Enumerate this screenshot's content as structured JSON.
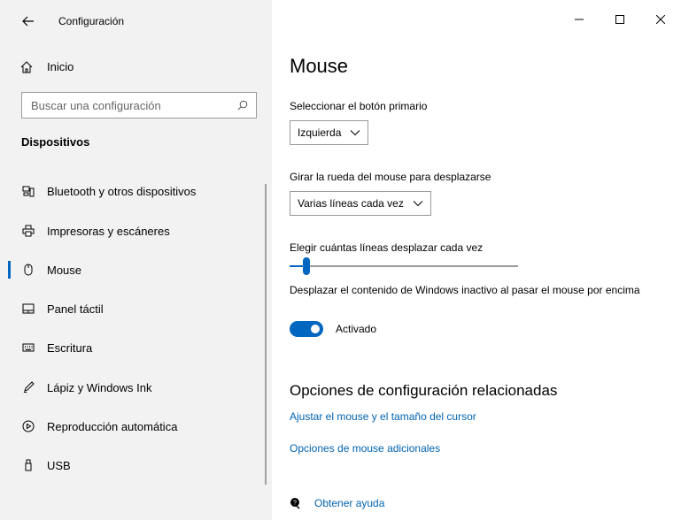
{
  "window": {
    "title": "Configuración"
  },
  "sidebar": {
    "home_label": "Inicio",
    "search_placeholder": "Buscar una configuración",
    "section_heading": "Dispositivos",
    "items": [
      {
        "label": "Bluetooth y otros dispositivos",
        "icon": "bluetooth-devices-icon"
      },
      {
        "label": "Impresoras y escáneres",
        "icon": "printer-icon"
      },
      {
        "label": "Mouse",
        "icon": "mouse-icon",
        "selected": true
      },
      {
        "label": "Panel táctil",
        "icon": "touchpad-icon"
      },
      {
        "label": "Escritura",
        "icon": "keyboard-icon"
      },
      {
        "label": "Lápiz y Windows Ink",
        "icon": "pen-icon"
      },
      {
        "label": "Reproducción automática",
        "icon": "autoplay-icon"
      },
      {
        "label": "USB",
        "icon": "usb-icon"
      }
    ]
  },
  "main": {
    "page_title": "Mouse",
    "primary_button": {
      "label": "Seleccionar el botón primario",
      "value": "Izquierda"
    },
    "scroll_wheel": {
      "label": "Girar la rueda del mouse para desplazarse",
      "value": "Varias líneas cada vez"
    },
    "lines_slider": {
      "label": "Elegir cuántas líneas desplazar cada vez",
      "level_fraction": 0.04
    },
    "inactive_scroll": {
      "label": "Desplazar el contenido de Windows inactivo al pasar el mouse por encima",
      "state_label": "Activado"
    },
    "related": {
      "title": "Opciones de configuración relacionadas",
      "link_1": "Ajustar el mouse y el tamaño del cursor",
      "link_2": "Opciones de mouse adicionales"
    },
    "help_label": "Obtener ayuda"
  },
  "colors": {
    "accent": "#0067c0",
    "link": "#0063b1",
    "sidebar_bg": "#f2f2f2"
  }
}
